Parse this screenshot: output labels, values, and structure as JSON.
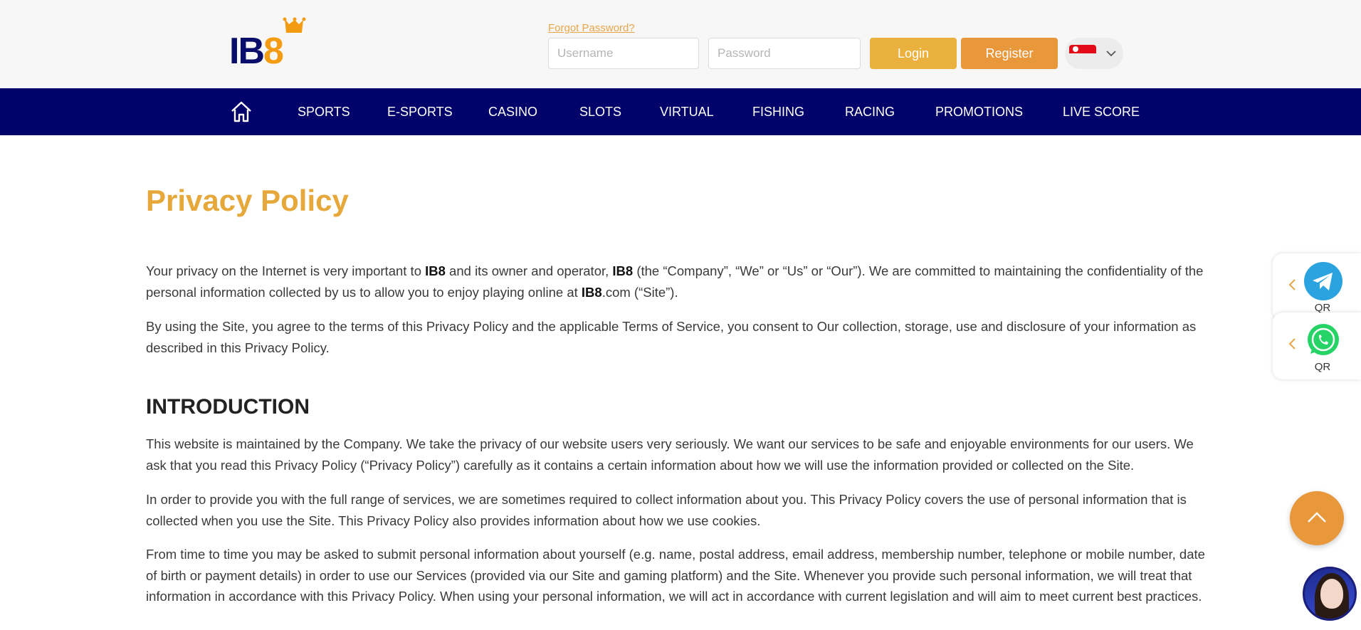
{
  "brand": {
    "logo_ib": "IB",
    "logo_eight": "8",
    "colors": {
      "navy": "#02026b",
      "gold": "#e6a83a",
      "orange": "#e8973a"
    }
  },
  "header": {
    "forgot_password": "Forgot Password?",
    "username_placeholder": "Username",
    "password_placeholder": "Password",
    "login_label": "Login",
    "register_label": "Register",
    "language_flag": "singapore-flag-icon"
  },
  "nav": {
    "home_icon": "home-icon",
    "items": [
      "SPORTS",
      "E-SPORTS",
      "CASINO",
      "SLOTS",
      "VIRTUAL",
      "FISHING",
      "RACING",
      "PROMOTIONS",
      "LIVE SCORE"
    ]
  },
  "content": {
    "title": "Privacy Policy",
    "p1_a": "Your privacy on the Internet is very important to ",
    "p1_b": "IB8",
    "p1_c": " and its owner and operator, ",
    "p1_d": "IB8",
    "p1_e": " (the “Company”, “We” or “Us” or “Our”). We are committed to maintaining the confidentiality of the personal information collected by us to allow you to enjoy playing online at ",
    "p1_f": "IB8",
    "p1_g": ".com (“Site”).",
    "p2": "By using the Site, you agree to the terms of this Privacy Policy and the applicable Terms of Service, you consent to Our collection, storage, use and disclosure of your information as described in this Privacy Policy.",
    "h_intro": "INTRODUCTION",
    "p3": "This website is maintained by the Company. We take the privacy of our website users very seriously. We want our services to be safe and enjoyable environments for our users. We ask that you read this Privacy Policy (“Privacy Policy”) carefully as it contains a certain information about how we will use the information provided or collected on the Site.",
    "p4": "In order to provide you with the full range of services, we are sometimes required to collect information about you. This Privacy Policy covers the use of personal information that is collected when you use the Site. This Privacy Policy also provides information about how we use cookies.",
    "p5": "From time to time you may be asked to submit personal information about yourself (e.g. name, postal address, email address, membership number, telephone or mobile number, date of birth or payment details) in order to use our Services (provided via our Site and gaming platform) and the Site. Whenever you provide such personal information, we will treat that information in accordance with this Privacy Policy. When using your personal information, we will act in accordance with current legislation and will aim to meet current best practices."
  },
  "side": {
    "telegram_qr": "QR",
    "whatsapp_qr": "QR"
  }
}
